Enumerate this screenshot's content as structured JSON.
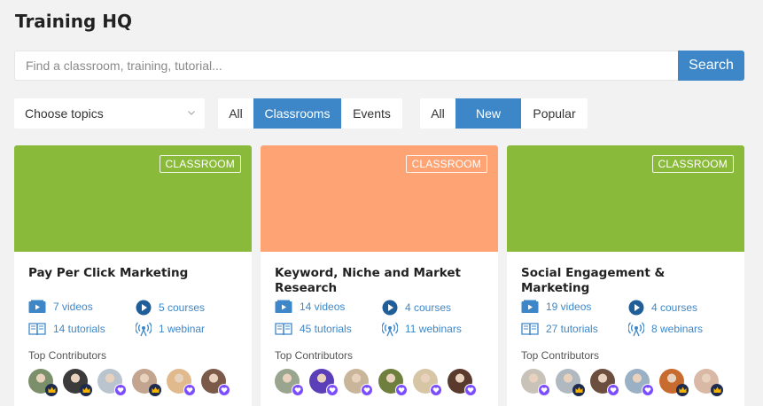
{
  "page": {
    "title": "Training HQ"
  },
  "search": {
    "placeholder": "Find a classroom, training, tutorial...",
    "button_label": "Search"
  },
  "filters": {
    "topics_label": "Choose topics",
    "type_options": [
      "All",
      "Classrooms",
      "Events"
    ],
    "type_selected": "Classrooms",
    "sort_options": [
      "All",
      "New",
      "Popular"
    ],
    "sort_selected": "New"
  },
  "colors": {
    "accent": "#3d87c9",
    "green": "#8aba3a",
    "orange": "#fea474",
    "badge_dark": "#1f2b4d",
    "badge_purple": "#7c4dff"
  },
  "cards": [
    {
      "tag": "CLASSROOM",
      "banner_color": "#8aba3a",
      "title": "Pay Per Click Marketing",
      "videos": "7 videos",
      "courses": "5 courses",
      "tutorials": "14 tutorials",
      "webinars": "1 webinar",
      "contributors_label": "Top Contributors"
    },
    {
      "tag": "CLASSROOM",
      "banner_color": "#fea474",
      "title": "Keyword, Niche and Market Research",
      "videos": "14 videos",
      "courses": "4 courses",
      "tutorials": "45 tutorials",
      "webinars": "11 webinars",
      "contributors_label": "Top Contributors"
    },
    {
      "tag": "CLASSROOM",
      "banner_color": "#8aba3a",
      "title": "Social Engagement & Marketing",
      "videos": "19 videos",
      "courses": "4 courses",
      "tutorials": "27 tutorials",
      "webinars": "8 webinars",
      "contributors_label": "Top Contributors"
    }
  ],
  "icons": {
    "video": "video-icon",
    "course": "play-circle-icon",
    "tutorial": "book-icon",
    "webinar": "broadcast-icon",
    "crown": "crown-icon",
    "heart": "heart-icon"
  }
}
